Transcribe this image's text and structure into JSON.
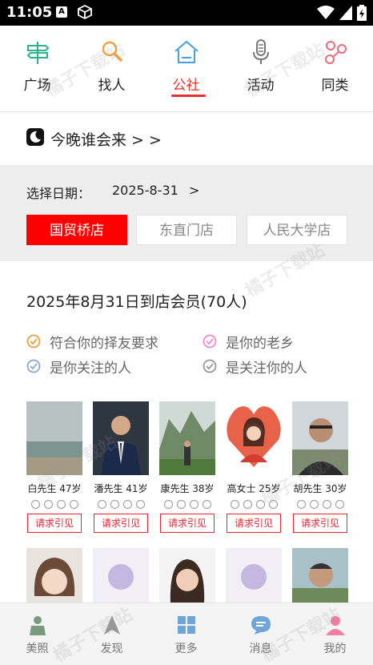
{
  "status_bar": {
    "time": "11:05",
    "notification_letter": "A"
  },
  "top_nav": {
    "items": [
      {
        "label": "广场",
        "icon": "signpost-icon",
        "active": false
      },
      {
        "label": "找人",
        "icon": "magnifier-icon",
        "active": false
      },
      {
        "label": "公社",
        "icon": "house-icon",
        "active": true
      },
      {
        "label": "活动",
        "icon": "microphone-icon",
        "active": false
      },
      {
        "label": "同类",
        "icon": "people-link-icon",
        "active": false
      }
    ]
  },
  "tonight": {
    "label": "今晚谁会来 > >"
  },
  "date_select": {
    "label": "选择日期：",
    "value": "2025-8-31",
    "arrow": ">"
  },
  "stores": [
    {
      "label": "国贸桥店",
      "active": true
    },
    {
      "label": "东直门店",
      "active": false
    },
    {
      "label": "人民大学店",
      "active": false
    }
  ],
  "members": {
    "title": "2025年8月31日到店会员(70人)",
    "legend": [
      {
        "label": "符合你的择友要求",
        "color": "#f0a23a"
      },
      {
        "label": "是你的老乡",
        "color": "#f28bd0"
      },
      {
        "label": "是你关注的人",
        "color": "#8fa6cf"
      },
      {
        "label": "是关注你的人",
        "color": "#999999"
      }
    ],
    "request_label": "请求引见",
    "cards": [
      {
        "name": "白先生 47岁",
        "photo": "sea-photo"
      },
      {
        "name": "潘先生 41岁",
        "photo": "suit-man-photo"
      },
      {
        "name": "康先生 38岁",
        "photo": "mountain-photo"
      },
      {
        "name": "高女士 25岁",
        "photo": "heart-woman-photo"
      },
      {
        "name": "胡先生 30岁",
        "photo": "glasses-man-photo"
      },
      {
        "name": "",
        "photo": "woman-photo"
      },
      {
        "name": "",
        "photo": "placeholder-avatar"
      },
      {
        "name": "",
        "photo": "woman-photo-2"
      },
      {
        "name": "",
        "photo": "placeholder-avatar"
      },
      {
        "name": "",
        "photo": "man-outdoor-photo"
      }
    ]
  },
  "tabbar": {
    "items": [
      {
        "label": "美照",
        "icon": "person-icon",
        "color": "#7a9a80"
      },
      {
        "label": "发现",
        "icon": "navigation-arrow-icon",
        "color": "#999999"
      },
      {
        "label": "更多",
        "icon": "grid-icon",
        "color": "#6fa6d9"
      },
      {
        "label": "消息",
        "icon": "chat-bubble-icon",
        "color": "#6fa6d9"
      },
      {
        "label": "我的",
        "icon": "profile-icon",
        "color": "#ef7fa4"
      }
    ]
  },
  "watermark": "橘子下载站",
  "colors": {
    "accent": "#e4312b",
    "store_active": "#ff0000"
  }
}
